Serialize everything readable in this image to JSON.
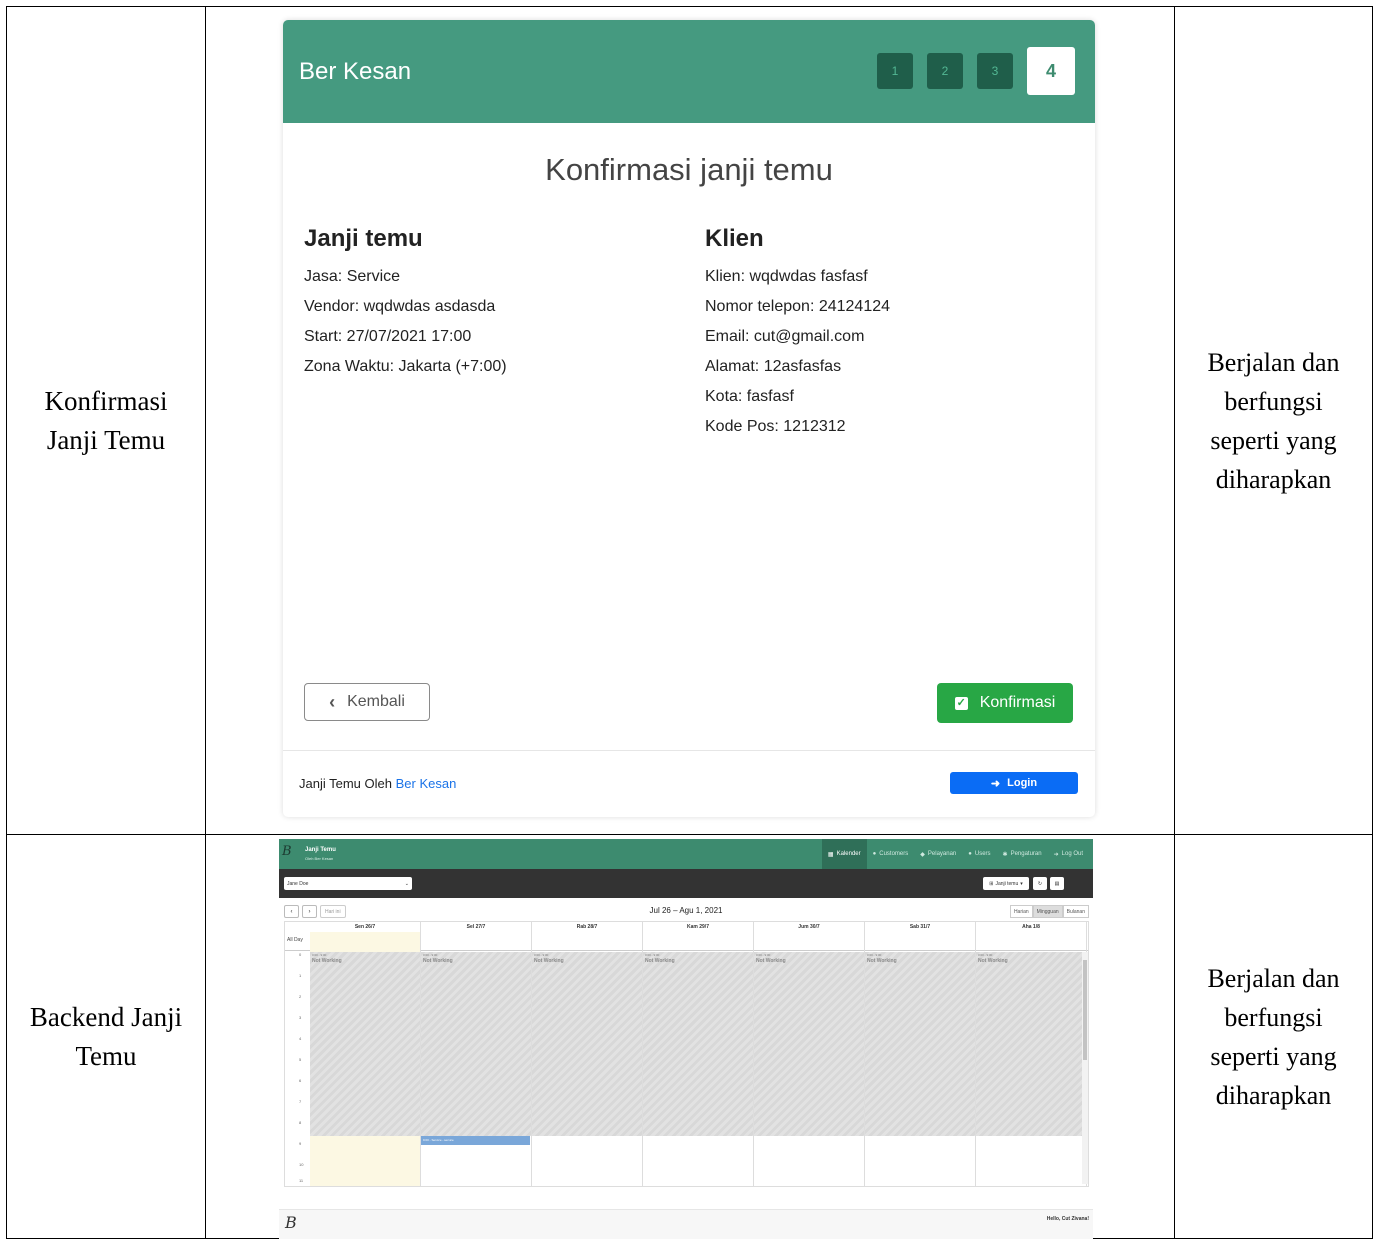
{
  "rows": [
    {
      "label_lines": [
        "Konfirmasi",
        "Janji Temu"
      ],
      "status_lines": [
        "Berjalan dan",
        "berfungsi",
        "seperti yang",
        "diharapkan"
      ]
    },
    {
      "label_lines": [
        "Backend Janji",
        "Temu"
      ],
      "status_lines": [
        "Berjalan dan",
        "berfungsi",
        "seperti yang",
        "diharapkan"
      ]
    }
  ],
  "wizard": {
    "brand": "Ber Kesan",
    "steps": [
      "1",
      "2",
      "3",
      "4"
    ],
    "active_step": 4,
    "title": "Konfirmasi janji temu",
    "appointment": {
      "heading": "Janji temu",
      "lines": [
        "Jasa: Service",
        "Vendor: wqdwdas asdasda",
        "Start: 27/07/2021 17:00",
        "Zona Waktu: Jakarta (+7:00)"
      ]
    },
    "client": {
      "heading": "Klien",
      "lines": [
        "Klien: wqdwdas fasfasf",
        "Nomor telepon: 24124124",
        "Email: cut@gmail.com",
        "Alamat: 12asfasfas",
        "Kota: fasfasf",
        "Kode Pos: 1212312"
      ]
    },
    "back_label": "Kembali",
    "confirm_label": "Konfirmasi",
    "footer_prefix": "Janji Temu Oleh",
    "footer_link": "Ber Kesan",
    "login_label": "Login",
    "colors": {
      "header": "#459a80",
      "confirm": "#28a745",
      "login": "#0a6cf5"
    }
  },
  "backend": {
    "title": "Janji Temu",
    "subtitle": "Oleh Ber Kesan",
    "menu": [
      "Kalender",
      "Customers",
      "Pelayanan",
      "Users",
      "Pengaturan",
      "Log Out"
    ],
    "active_menu": "Kalender",
    "provider_select": "Jane Doe",
    "new_appointment": "Janji temu",
    "today_button": "Hari ini",
    "date_range": "Jul 26 – Agu 1, 2021",
    "views": [
      "Harian",
      "Mingguan",
      "Bulanan"
    ],
    "active_view": "Mingguan",
    "all_day": "All Day",
    "days": [
      "Sen 26/7",
      "Sel 27/7",
      "Rab 28/7",
      "Kam 29/7",
      "Jum 30/7",
      "Sab 31/7",
      "Aha 1/8"
    ],
    "hours": [
      "0",
      "1",
      "2",
      "3",
      "4",
      "5",
      "6",
      "7",
      "8",
      "9",
      "10",
      "11"
    ],
    "not_working": "Not Working",
    "not_working_time": "0:00 - 9:00",
    "appointment_text": "9:00 - Service - service",
    "footer_greeting": "Hello, Cut Zivana!"
  }
}
